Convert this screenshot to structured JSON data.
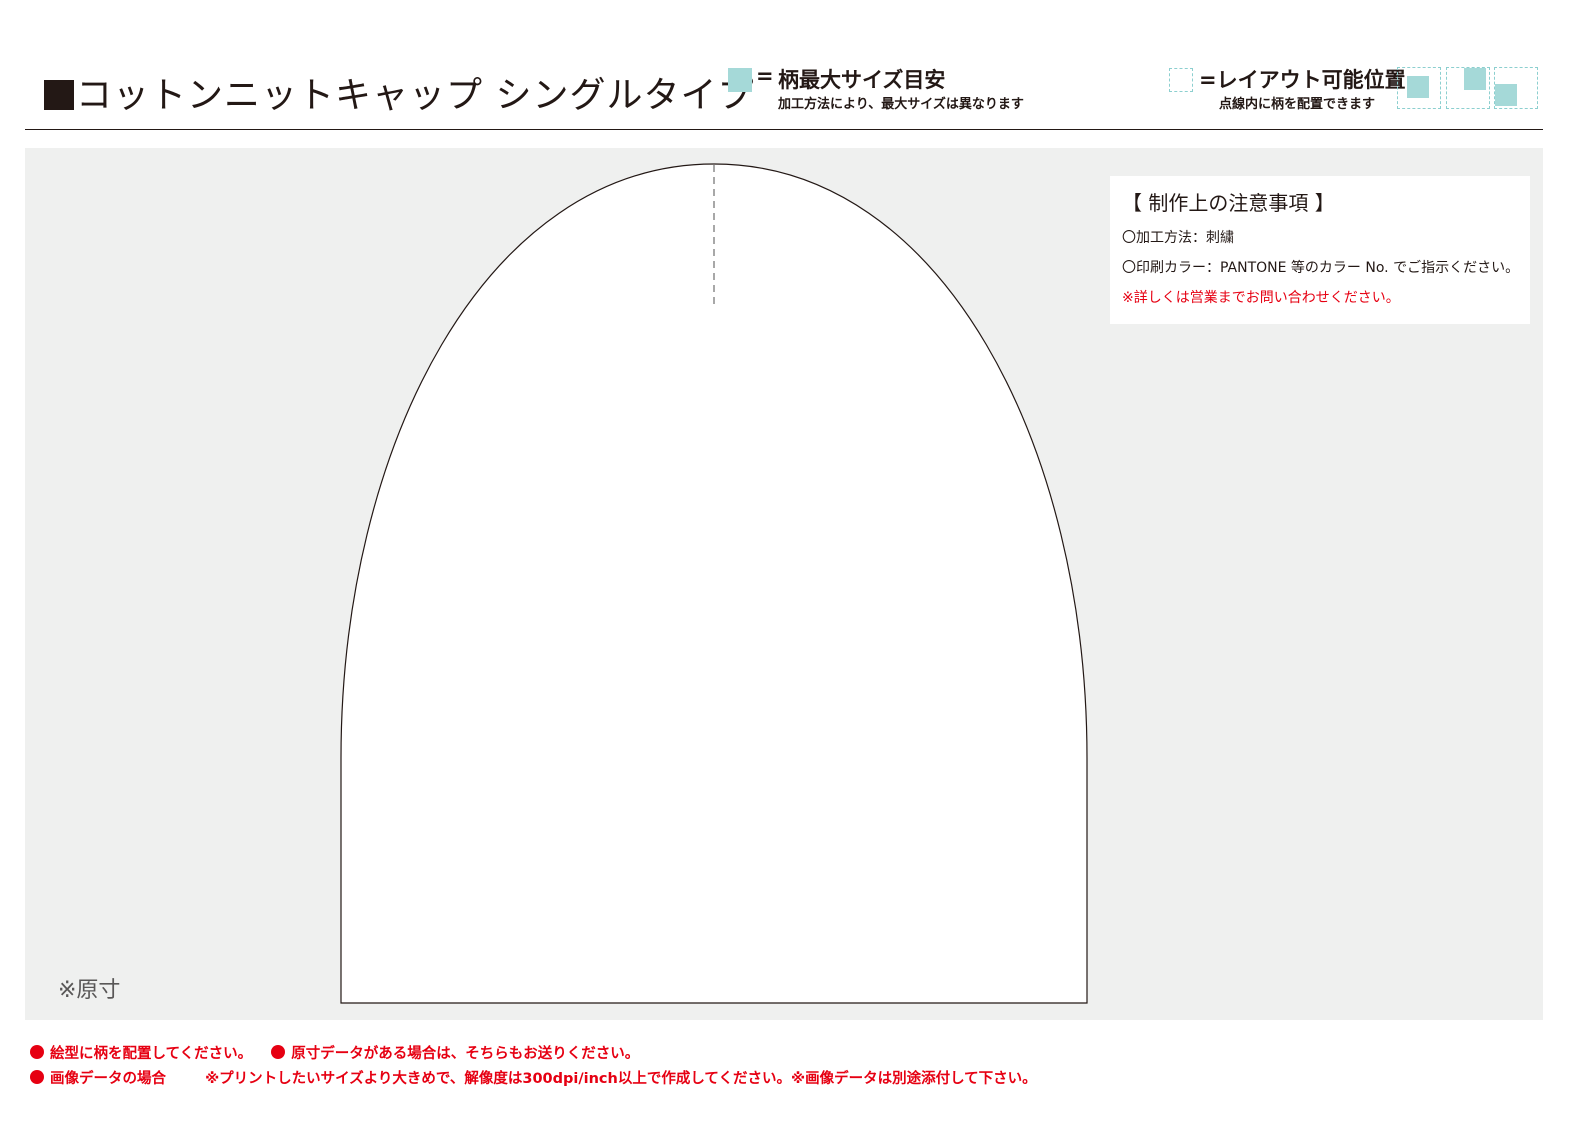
{
  "header": {
    "title": "コットンニットキャップ シングルタイプ",
    "legend_max_size": {
      "equals": "=",
      "label": "柄最大サイズ目安",
      "note": "加工方法により、最大サイズは異なります",
      "swatch_color": "#a5d9d8"
    },
    "legend_layout": {
      "label": "=レイアウト可能位置",
      "note": "点線内に柄を配置できます",
      "dash_color": "#8ccfcf"
    }
  },
  "notes": {
    "heading": "【 制作上の注意事項 】",
    "method": "〇加工方法：刺繍",
    "color": "〇印刷カラー：PANTONE 等のカラー No. でご指示ください。",
    "contact": "※詳しくは営業までお問い合わせください。"
  },
  "scale_note": "※原寸",
  "footer": {
    "line1_item1": "絵型に柄を配置してください。",
    "line1_item2": "原寸データがある場合は、そちらもお送りください。",
    "line2_item1": "画像データの場合",
    "line2_item2": "※プリントしたいサイズより大きめで、解像度は300dpi/inch以上で作成してください。※画像データは別途添付して下さい。"
  },
  "colors": {
    "accent_red": "#e60012",
    "panel_bg": "#eff0ef",
    "text": "#231815"
  }
}
